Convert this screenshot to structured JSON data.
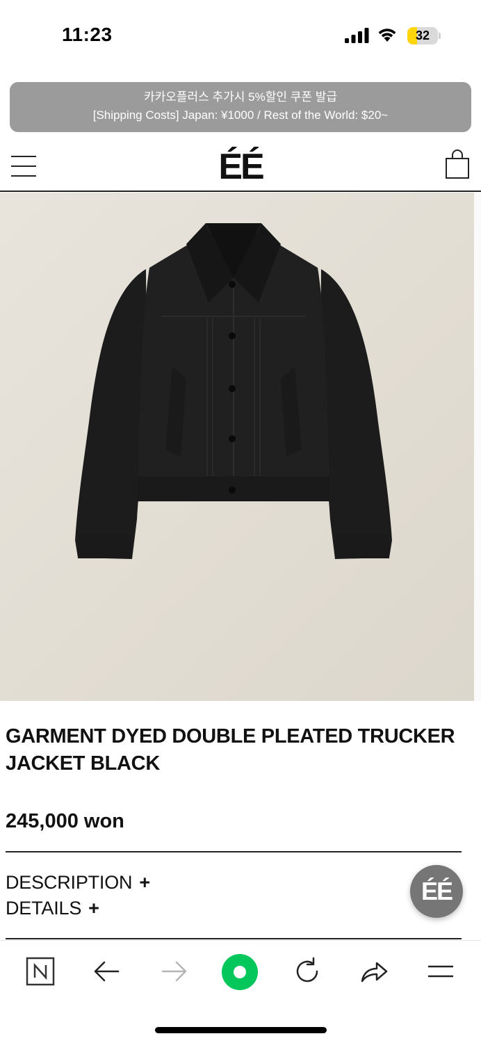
{
  "status_bar": {
    "time": "11:23",
    "battery_level": "32",
    "battery_fraction": 0.32,
    "battery_color": "#ffd60a"
  },
  "notice": {
    "line1": "카카오플러스 추가시 5%할인 쿠폰 발급",
    "line2": "[Shipping Costs] Japan: ¥1000 / Rest of the World: $20~"
  },
  "header": {
    "logo": "ÉÉ",
    "menu_icon": "hamburger-menu-icon",
    "cart_icon": "shopping-bag-icon"
  },
  "product": {
    "image_subject": "black trucker jacket",
    "title": "GARMENT DYED DOUBLE PLEATED TRUCKER JACKET BLACK",
    "price": "245,000 won"
  },
  "sections": {
    "description_label": "DESCRIPTION",
    "details_label": "DETAILS",
    "expand_symbol": "+"
  },
  "floating_button": {
    "label": "ÉÉ"
  },
  "browser_toolbar": {
    "items": [
      "naver-home-icon",
      "back-arrow-icon",
      "forward-arrow-icon",
      "green-circle-icon",
      "reload-icon",
      "share-icon",
      "menu-icon"
    ],
    "accent": "#03c75a"
  }
}
